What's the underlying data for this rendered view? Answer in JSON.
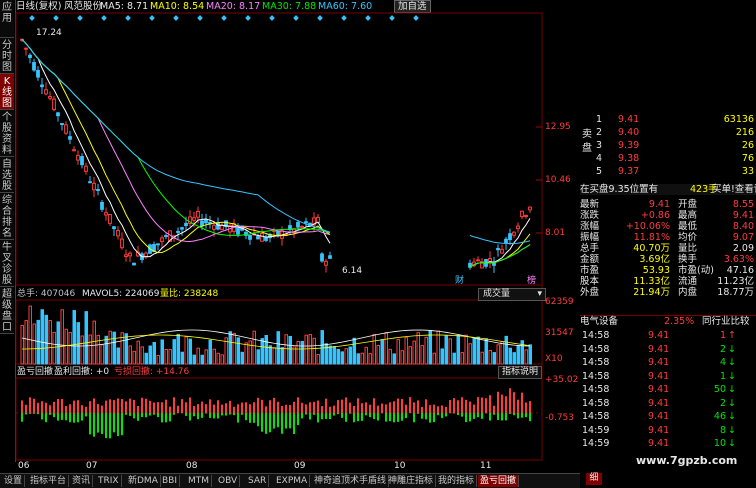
{
  "left_tabs": [
    "应用",
    "分时图",
    "K线图",
    "个股资料",
    "自选股",
    "综合排名",
    "牛叉诊股",
    "超级盘口"
  ],
  "top": {
    "period": "日线(复权)",
    "stock": "风范股份",
    "ma5": "MA5: 8.71",
    "ma10": "MA10: 8.54",
    "ma20": "MA20: 8.17",
    "ma30": "MA30: 7.88",
    "ma60": "MA60: 7.60",
    "add_btn": "加自选"
  },
  "price_axis": [
    "12.95",
    "10.46",
    "8.01"
  ],
  "price_marks": {
    "high": "17.24",
    "low": "6.14",
    "cai": "财",
    "bang": "榜"
  },
  "volume_header": {
    "total": "总手: 407046",
    "mavol5": "MAVOL5: 224069",
    "ratio": "量比: 238248",
    "dropdown": "成交量"
  },
  "volume_axis": [
    "62359",
    "31547",
    "X10"
  ],
  "pl_header": {
    "title": "盈亏回撤",
    "profit": "盈利回撤: +0",
    "loss": "亏损回撤: +14.76",
    "help": "指标说明"
  },
  "pl_axis": [
    "+35.02",
    "-0.753"
  ],
  "date_axis": [
    "06",
    "07",
    "08",
    "09",
    "10",
    "11"
  ],
  "bottom_tabs": [
    "设置",
    "指标平台",
    "资讯",
    "TRIX",
    "新DMA",
    "BBI",
    "MTM",
    "OBV",
    "SAR",
    "EXPMA",
    "神奇追顶术手盾线",
    "神雕庄指标",
    "我的指标",
    "盈亏回撤"
  ],
  "sell_side_label": "卖盘",
  "asks": [
    {
      "lvl": "1",
      "price": "9.41",
      "vol": "63136"
    },
    {
      "lvl": "2",
      "price": "9.40",
      "vol": "216"
    },
    {
      "lvl": "3",
      "price": "9.39",
      "vol": "26"
    },
    {
      "lvl": "4",
      "price": "9.38",
      "vol": "76"
    },
    {
      "lvl": "5",
      "price": "9.37",
      "vol": "33"
    }
  ],
  "bid_line": {
    "text": "在买盘9.35位置有",
    "vol": "423手",
    "action": "买单!查看详细"
  },
  "quote": [
    [
      "最新",
      "9.41",
      "开盘",
      "8.55"
    ],
    [
      "涨跌",
      "+0.86",
      "最高",
      "9.41"
    ],
    [
      "涨幅",
      "+10.06%",
      "最低",
      "8.40"
    ],
    [
      "振幅",
      "11.81%",
      "均价",
      "9.07"
    ],
    [
      "总手",
      "40.70万",
      "量比",
      "2.09"
    ],
    [
      "金额",
      "3.69亿",
      "换手",
      "3.63%"
    ],
    [
      "市盈",
      "53.93",
      "市盈(动)",
      "47.16"
    ],
    [
      "股本",
      "11.33亿",
      "流通",
      "11.23亿"
    ],
    [
      "外盘",
      "21.94万",
      "内盘",
      "18.77万"
    ]
  ],
  "industry": {
    "name": "电气设备",
    "change": "2.35%",
    "link": "同行业比较"
  },
  "ticks": [
    [
      "14:58",
      "9.41",
      "1",
      "up"
    ],
    [
      "14:58",
      "9.41",
      "2",
      "down"
    ],
    [
      "14:58",
      "9.41",
      "4",
      "down"
    ],
    [
      "14:58",
      "9.41",
      "1",
      "down"
    ],
    [
      "14:58",
      "9.41",
      "50",
      "down"
    ],
    [
      "14:58",
      "9.41",
      "2",
      "down"
    ],
    [
      "14:58",
      "9.41",
      "46",
      "down"
    ],
    [
      "14:59",
      "9.41",
      "8",
      "down"
    ],
    [
      "14:59",
      "9.41",
      "10",
      "down"
    ]
  ],
  "watermark": "www.7gpzb.com",
  "detail_tab": "细",
  "colors": {
    "up": "#ff3c3c",
    "down": "#00e600",
    "ma5": "#ffffff",
    "ma10": "#ffff00",
    "ma20": "#ff80ff",
    "ma30": "#00ff00",
    "ma60": "#36c4ff"
  }
}
